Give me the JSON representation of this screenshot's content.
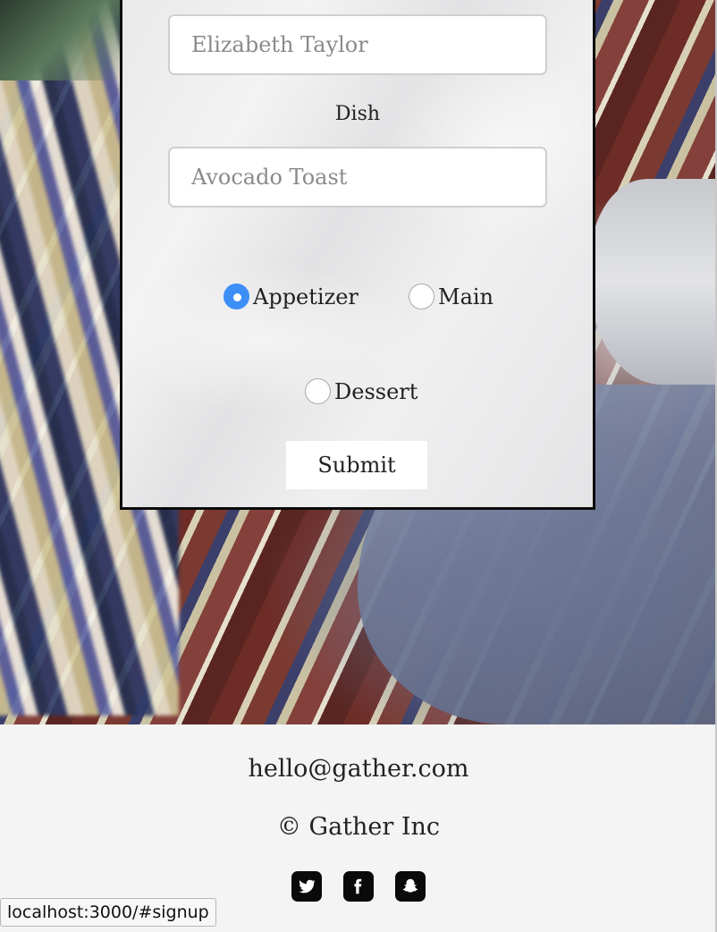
{
  "form": {
    "name_placeholder": "Elizabeth Taylor",
    "dish_label": "Dish",
    "dish_placeholder": "Avocado Toast",
    "course_options": [
      {
        "label": "Appetizer",
        "checked": true
      },
      {
        "label": "Main",
        "checked": false
      },
      {
        "label": "Dessert",
        "checked": false
      }
    ],
    "submit_label": "Submit"
  },
  "footer": {
    "email": "hello@gather.com",
    "copyright": "© Gather Inc",
    "socials": [
      "twitter-icon",
      "facebook-icon",
      "snapchat-icon"
    ]
  },
  "status_bar": {
    "url": "localhost:3000/#signup"
  },
  "colors": {
    "radio_checked": "#3d8ff7",
    "footer_bg": "#f4f4f4",
    "card_border": "#0b0b0b"
  }
}
